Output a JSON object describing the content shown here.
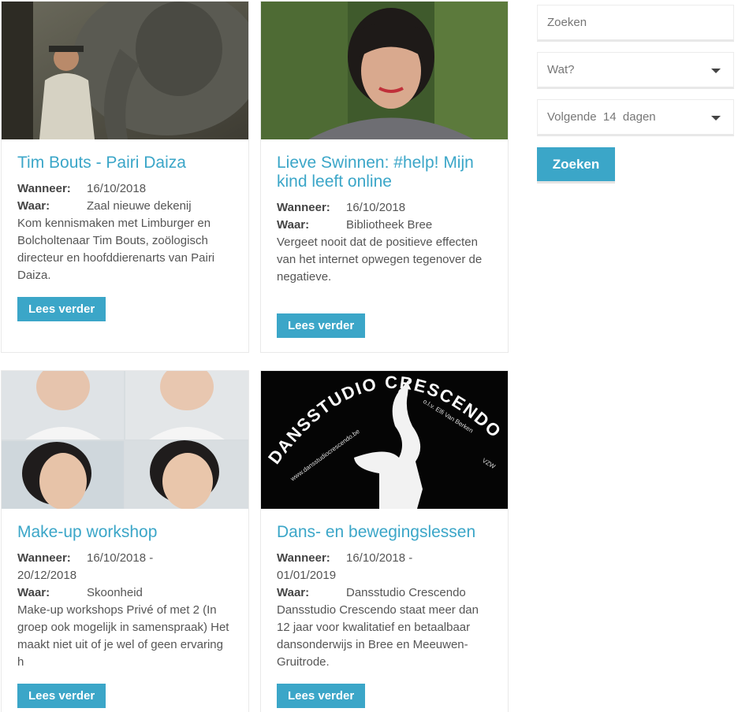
{
  "events": [
    {
      "title": "Tim Bouts - Pairi Daiza",
      "when_label": "Wanneer:",
      "when": "16/10/2018",
      "where_label": "Waar:",
      "where": "Zaal nieuwe dekenij",
      "description": "Kom kennismaken met Limburger en Bolcholtenaar Tim Bouts, zoölogisch directeur en hoofddierenarts van Pairi Daiza.",
      "button": "Lees verder"
    },
    {
      "title": "Lieve Swinnen: #help! Mijn kind leeft online",
      "when_label": "Wanneer:",
      "when": "16/10/2018",
      "where_label": "Waar:",
      "where": "Bibliotheek Bree",
      "description": "Vergeet nooit dat de positieve effecten van het internet opwegen tegenover de negatieve.",
      "button": "Lees verder"
    },
    {
      "title": "Make-up workshop",
      "when_label": "Wanneer:",
      "when": "16/10/2018  -",
      "when_end": "20/12/2018",
      "where_label": "Waar:",
      "where": "Skoonheid",
      "description": "Make-up workshops Privé of met 2 (In groep ook mogelijk in samenspraak) Het maakt niet uit of je wel of geen ervaring h",
      "button": "Lees verder"
    },
    {
      "title": "Dans- en bewegingslessen",
      "when_label": "Wanneer:",
      "when": "16/10/2018  -",
      "when_end": "01/01/2019",
      "where_label": "Waar:",
      "where": "Dansstudio Crescendo",
      "description": "Dansstudio Crescendo staat meer dan 12 jaar voor kwalitatief en betaalbaar dansonderwijs in Bree en Meeuwen-Gruitrode.",
      "button": "Lees verder",
      "image_text": {
        "arc": "DANSSTUDIO CRESCENDO",
        "url": "www.dansstudiocrescendo.be",
        "sub": "o.l.v. Elfi Van Berken",
        "vzw": "VZW"
      }
    }
  ],
  "sidebar": {
    "search_placeholder": "Zoeken",
    "what_select": "Wat?",
    "period_select": "Volgende  14  dagen",
    "search_button": "Zoeken"
  },
  "colors": {
    "accent": "#3ba6c8"
  }
}
